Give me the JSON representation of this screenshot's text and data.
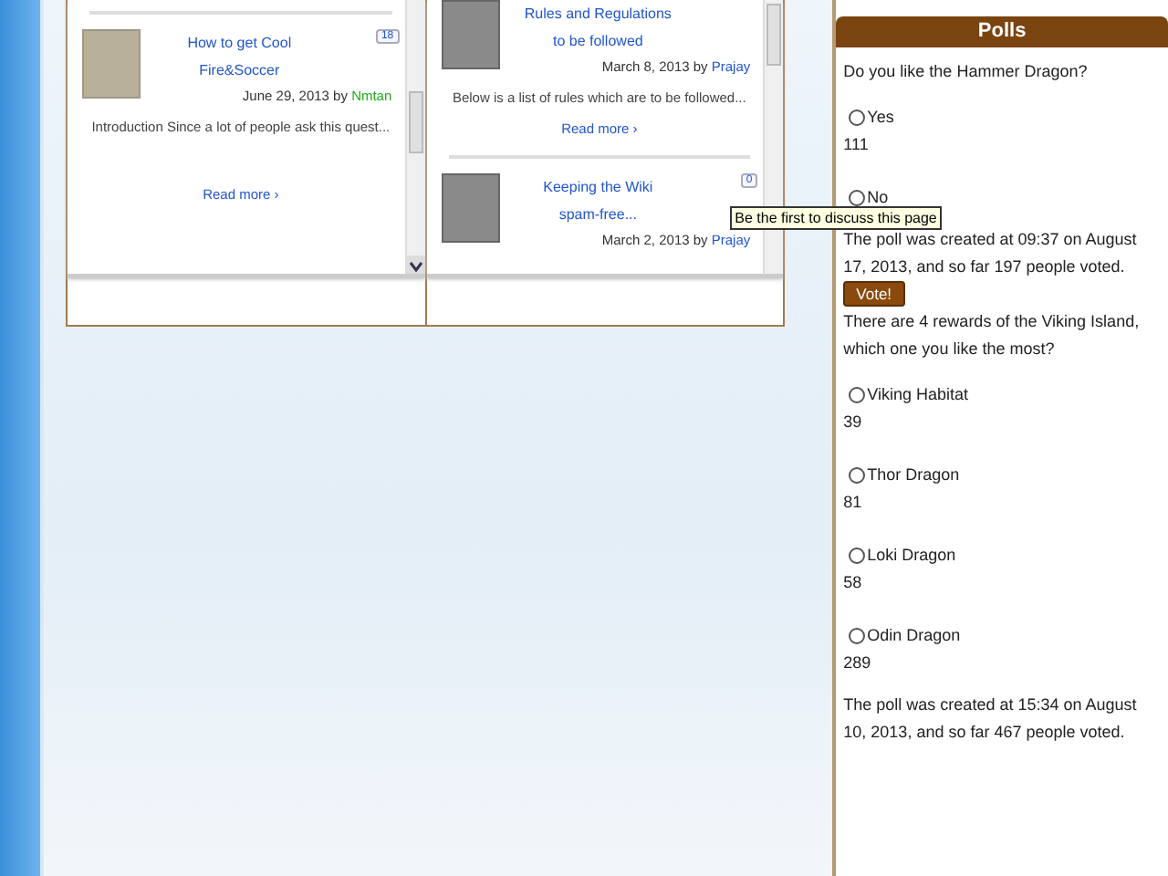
{
  "posts_left": [
    {
      "title": "How to get Cool Fire&Soccer",
      "date": "June 29, 2013 by",
      "author": "Nmtan",
      "comments": "18",
      "excerpt": "Introduction Since a lot of people ask this quest...",
      "read_more": "Read more ›"
    }
  ],
  "posts_right": [
    {
      "title": "Rules and Regulations to be followed",
      "date": "March 8, 2013 by",
      "author": "Prajay",
      "excerpt": "Below is a list of rules which are to be followed...",
      "read_more": "Read more ›"
    },
    {
      "title": "Keeping the Wiki spam-free...",
      "date": "March 2, 2013 by",
      "author": "Prajay",
      "comments": "0"
    }
  ],
  "tooltip": "Be the first to discuss this page",
  "polls": {
    "title": "Polls",
    "items": [
      {
        "question": "Do you like the Hammer Dragon?",
        "options": [
          {
            "label": "Yes",
            "count": "111",
            "selected": false
          },
          {
            "label": "No",
            "selected": false
          }
        ],
        "summary": "The poll was created at 09:37 on August 17, 2013, and so far 197 people voted.",
        "button": "Vote!"
      },
      {
        "question": "There are 4 rewards of the Viking Island, which one you like the most?",
        "options": [
          {
            "label": "Viking Habitat",
            "count": "39",
            "selected": false
          },
          {
            "label": "Thor Dragon",
            "count": "81",
            "selected": false
          },
          {
            "label": "Loki Dragon",
            "count": "58",
            "selected": false
          },
          {
            "label": "Odin Dragon",
            "count": "289",
            "selected": false
          }
        ],
        "summary": "The poll was created at 15:34 on August 10, 2013, and so far 467 people voted."
      }
    ]
  }
}
